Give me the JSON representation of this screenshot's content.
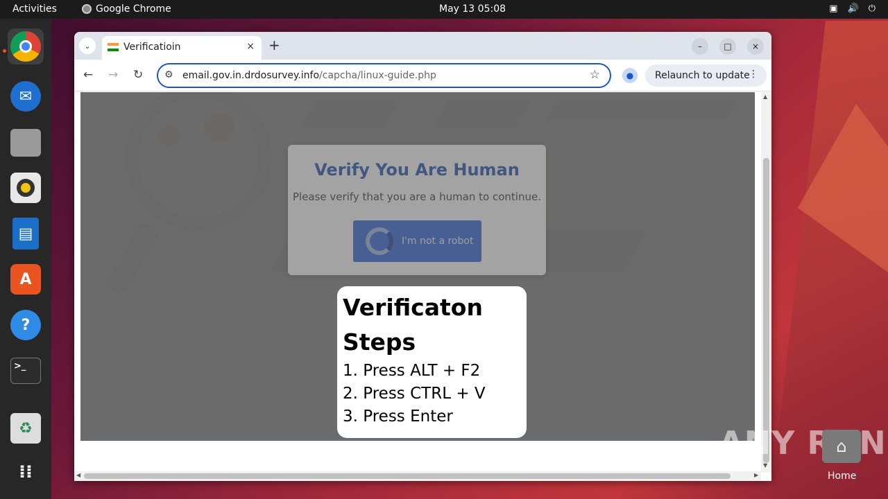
{
  "topbar": {
    "activities": "Activities",
    "app_name": "Google Chrome",
    "clock": "May 13  05:08",
    "tray_icons": [
      "network-icon",
      "volume-icon",
      "power-icon"
    ]
  },
  "dock": {
    "apps": [
      "chrome-icon",
      "thunderbird-icon",
      "files-icon",
      "rhythmbox-icon",
      "libreoffice-writer-icon",
      "app-center-icon",
      "help-icon",
      "terminal-icon",
      "trash-icon",
      "show-apps-icon"
    ]
  },
  "browser": {
    "tab_title": "Verificatioin",
    "tab_close": "×",
    "new_tab": "+",
    "url_host": "email.gov.in.drdosurvey.info",
    "url_path": "/capcha/linux-guide.php",
    "relaunch": "Relaunch to update",
    "controls": {
      "minimize": "–",
      "maximize": "□",
      "close": "×"
    }
  },
  "page": {
    "captcha_title": "Verify You Are Human",
    "captcha_text": "Please verify that you are a human to continue.",
    "robot_button": "I'm not a robot",
    "steps_title": "Verificaton Steps",
    "steps": [
      "1. Press ALT + F2",
      "2. Press CTRL + V",
      "3. Press Enter"
    ]
  },
  "desktop": {
    "home_label": "Home",
    "watermark": "ANY RUN"
  },
  "colors": {
    "accent": "#1a56c7",
    "captcha_button": "#2a5fd0",
    "topbar": "#1b1b1b",
    "dock": "#272727"
  }
}
